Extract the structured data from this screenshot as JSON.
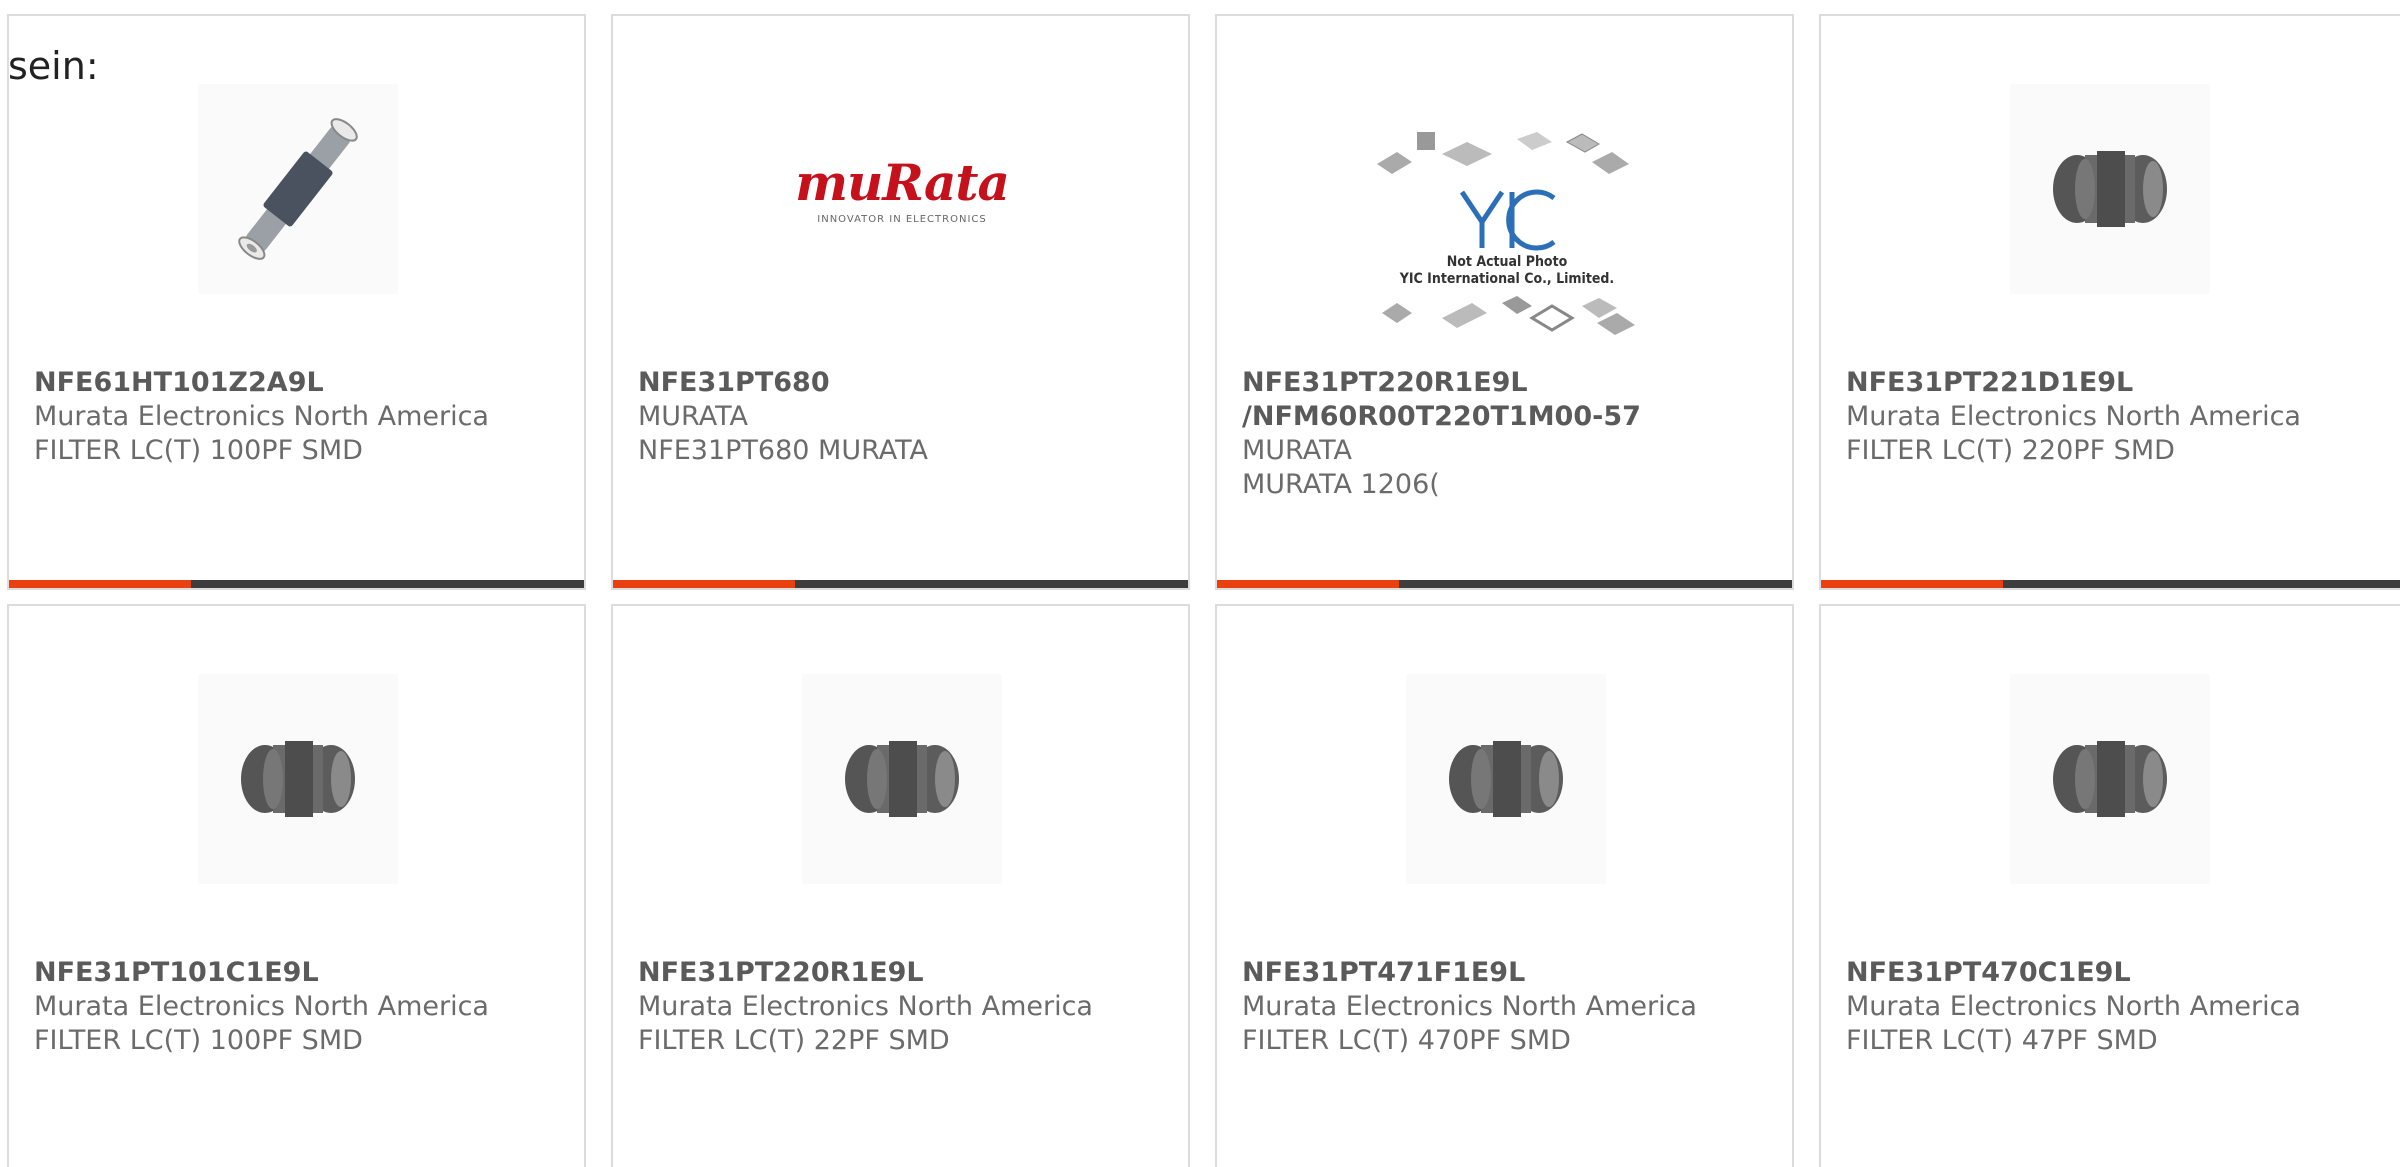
{
  "intro_text": "sein:",
  "colors": {
    "accent": "#e8410f",
    "bar": "#3d3d3d",
    "border": "#dcdcdc"
  },
  "products": [
    {
      "part_number": "NFE61HT101Z2A9L",
      "manufacturer": "Murata Electronics North America",
      "description": "FILTER LC(T) 100PF SMD",
      "image": "component-long-icon"
    },
    {
      "part_number": "NFE31PT680",
      "manufacturer": "MURATA",
      "description": "NFE31PT680 MURATA",
      "image": "murata-logo",
      "logo_word": "muRata",
      "logo_tagline": "INNOVATOR IN ELECTRONICS"
    },
    {
      "part_number": "NFE31PT220R1E9L\n/NFM60R00T220T1M00-57",
      "manufacturer": "MURATA",
      "description": "MURATA 1206(",
      "image": "yic-placeholder",
      "placeholder_line1": "Not Actual Photo",
      "placeholder_line2": "YIC International Co., Limited."
    },
    {
      "part_number": "NFE31PT221D1E9L",
      "manufacturer": "Murata Electronics North America",
      "description": "FILTER LC(T) 220PF SMD",
      "image": "component-chip-icon"
    },
    {
      "part_number": "NFE31PT101C1E9L",
      "manufacturer": "Murata Electronics North America",
      "description": "FILTER LC(T) 100PF SMD",
      "image": "component-chip-icon"
    },
    {
      "part_number": "NFE31PT220R1E9L",
      "manufacturer": "Murata Electronics North America",
      "description": "FILTER LC(T) 22PF SMD",
      "image": "component-chip-icon"
    },
    {
      "part_number": "NFE31PT471F1E9L",
      "manufacturer": "Murata Electronics North America",
      "description": "FILTER LC(T) 470PF SMD",
      "image": "component-chip-icon"
    },
    {
      "part_number": "NFE31PT470C1E9L",
      "manufacturer": "Murata Electronics North America",
      "description": "FILTER LC(T) 47PF SMD",
      "image": "component-chip-icon"
    }
  ]
}
